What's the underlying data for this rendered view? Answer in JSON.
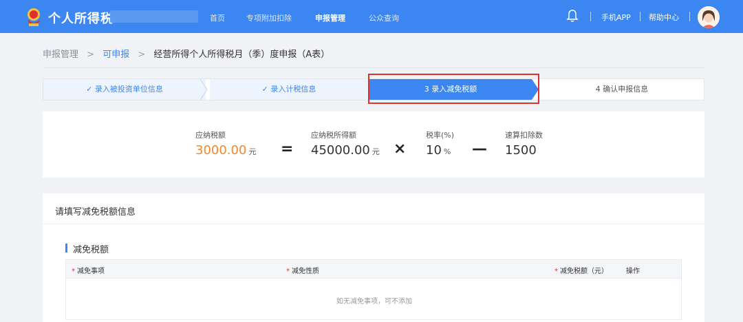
{
  "header": {
    "app_title": "个人所得税",
    "nav": [
      "首页",
      "专项附加扣除",
      "申报管理",
      "公众查询"
    ],
    "active_nav": "申报管理",
    "mobile_app": "手机APP",
    "help_center": "帮助中心",
    "colors": {
      "bar": "#3b86f0"
    }
  },
  "breadcrumb": {
    "items": [
      "申报管理",
      "可申报",
      "经营所得个人所得税月（季）度申报（A表）"
    ],
    "separator": ">"
  },
  "steps": [
    {
      "label": "✓ 录入被投资单位信息",
      "state": "done"
    },
    {
      "label": "✓ 录入计税信息",
      "state": "done"
    },
    {
      "label": "3 录入减免税额",
      "state": "active"
    },
    {
      "label": "4 确认申报信息",
      "state": "todo"
    }
  ],
  "formula": {
    "tax_payable_label": "应纳税额",
    "tax_payable_value": "3000.00",
    "tax_payable_unit": "元",
    "taxable_income_label": "应纳税所得额",
    "taxable_income_value": "45000.00",
    "taxable_income_unit": "元",
    "rate_label": "税率(%)",
    "rate_value": "10",
    "rate_unit": "%",
    "deduction_label": "速算扣除数",
    "deduction_value": "1500",
    "op_equals": "=",
    "op_times": "×",
    "op_minus": "—"
  },
  "reduction": {
    "panel_title": "请填写减免税额信息",
    "section_title": "减免税额",
    "columns": [
      "减免事项",
      "减免性质",
      "减免税额（元）",
      "操作"
    ],
    "required_mark": "*",
    "empty_text": "如无减免事项，可不添加"
  }
}
